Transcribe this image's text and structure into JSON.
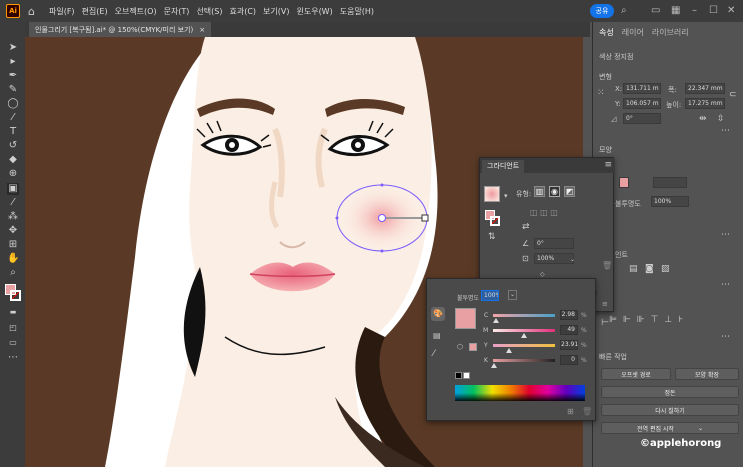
{
  "app": {
    "logo": "Ai"
  },
  "menu": [
    "파일(F)",
    "편집(E)",
    "오브젝트(O)",
    "문자(T)",
    "선택(S)",
    "효과(C)",
    "보기(V)",
    "윈도우(W)",
    "도움말(H)"
  ],
  "share_label": "공유",
  "document_tab": {
    "title": "인물그리기 [복구됨].ai* @ 150%(CMYK/미리 보기)",
    "close": "×"
  },
  "right_panel": {
    "tabs": [
      "속성",
      "레이어",
      "라이브러리"
    ],
    "section_shape": "색상 정지점",
    "section_transform": "변형",
    "x_label": "X:",
    "x_value": "131.711 m",
    "y_label": "Y:",
    "y_value": "106.057 m",
    "w_label": "폭:",
    "w_value": "22.347 mm",
    "h_label": "높이:",
    "h_value": "17.275 mm",
    "angle_value": "0°",
    "section_appearance": "모양",
    "opacity_label": "불투명도",
    "opacity_value": "100%",
    "gradient_label": "인트",
    "section_quick": "빠른 작업",
    "btn_offset": "오프셋 경로",
    "btn_expand": "모양 확장",
    "btn_ungroup": "정돈",
    "btn_recolor": "다시 칠하기",
    "btn_global_edit": "전역 편집 시작"
  },
  "gradient_panel": {
    "tab": "그라디언트",
    "type_label": "유형:",
    "angle_value": "0°",
    "opacity_value": "100%"
  },
  "color_panel": {
    "opacity_label": "불투명도",
    "opacity_value": "100%",
    "c_label": "C",
    "c_value": "2.98",
    "m_label": "M",
    "m_value": "49",
    "y_label": "Y",
    "y_value": "23.91",
    "k_label": "K",
    "k_value": "0",
    "percent": "%",
    "swatch_color": "#e8a0a2"
  },
  "watermark": "©applehorong",
  "colors": {
    "accent": "#1473e6",
    "hair": "#5a3a26",
    "skin": "#fbeee4",
    "lips": "#f0a4aa"
  }
}
